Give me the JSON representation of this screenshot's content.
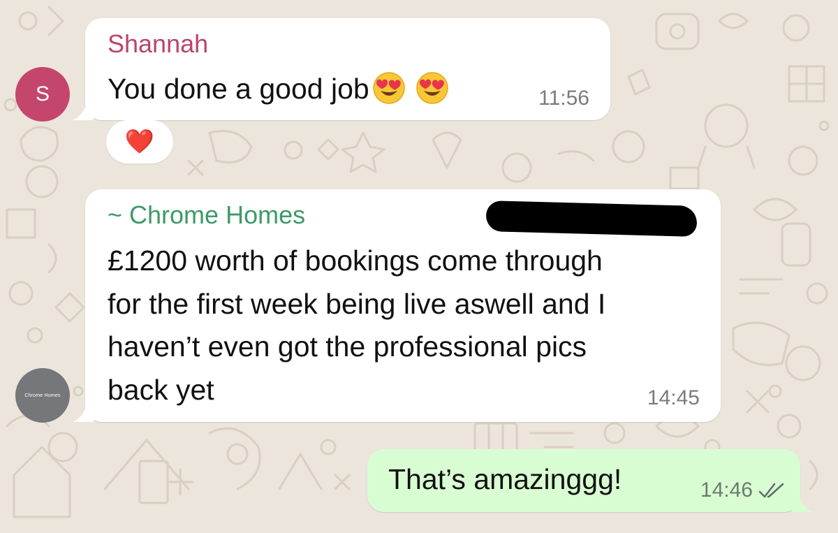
{
  "chat": {
    "messages": [
      {
        "sender": "Shannah",
        "avatar_initial": "S",
        "text": "You done a good job",
        "emojis": [
          "heart-eyes-emoji",
          "heart-eyes-emoji"
        ],
        "time": "11:56",
        "reaction": "❤️"
      },
      {
        "sender": "~ Chrome Homes",
        "avatar_label": "Chrome Homes",
        "sender_phone_redacted": true,
        "text": "£1200 worth of bookings come through\nfor the first week being live aswell and I\nhaven’t even got the professional pics\nback yet",
        "time": "14:45"
      },
      {
        "outgoing": true,
        "text": "That’s amazinggg!",
        "time": "14:46",
        "status": "read",
        "status_icon": "double-check-icon"
      }
    ]
  },
  "colors": {
    "wallpaper": "#ece5dc",
    "incoming_bubble": "#ffffff",
    "outgoing_bubble": "#d9fdd3",
    "shannah_name": "#b9446d",
    "chrome_homes_name": "#3d9a67",
    "avatar_s": "#c4466d",
    "avatar_chrome_homes": "#75777a",
    "timestamp": "#7b7b7b"
  }
}
